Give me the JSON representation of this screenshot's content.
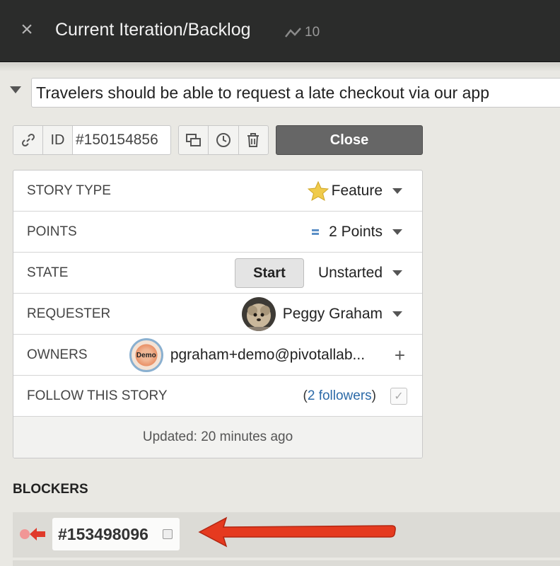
{
  "header": {
    "close_icon": "close-icon",
    "title": "Current Iteration/Backlog",
    "velocity_icon": "velocity-icon",
    "velocity_value": "10"
  },
  "story": {
    "name": "Travelers should be able to request a late checkout via our app",
    "id_label": "ID",
    "id_value": "#150154856",
    "close_label": "Close"
  },
  "fields": {
    "story_type": {
      "label": "STORY TYPE",
      "value": "Feature",
      "icon": "star-icon"
    },
    "points": {
      "label": "POINTS",
      "value": "2 Points",
      "icon": "points-icon"
    },
    "state": {
      "label": "STATE",
      "start_label": "Start",
      "value": "Unstarted"
    },
    "requester": {
      "label": "REQUESTER",
      "value": "Peggy Graham"
    },
    "owners": {
      "label": "OWNERS",
      "avatar_text": "Demo",
      "value": "pgraham+demo@pivotallab...",
      "add": "+"
    },
    "follow": {
      "label": "FOLLOW THIS STORY",
      "open_paren": "(",
      "followers_link": "2 followers",
      "close_paren": ")",
      "check": "✓"
    }
  },
  "updated": "Updated: 20 minutes ago",
  "blockers": {
    "title": "BLOCKERS",
    "items": [
      {
        "id": "#153498096"
      }
    ]
  },
  "colors": {
    "topbar": "#2b2c2b",
    "close_button": "#666666",
    "link": "#2c6aa8",
    "annotation_arrow": "#e53a1f"
  }
}
